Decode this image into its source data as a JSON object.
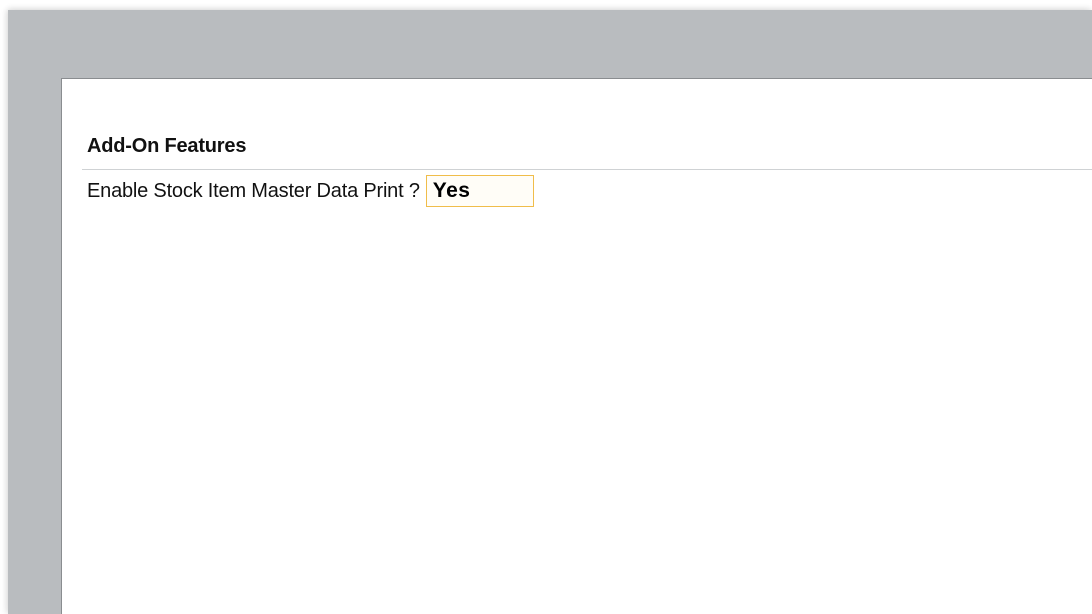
{
  "section": {
    "title": "Add-On Features"
  },
  "fields": [
    {
      "label": "Enable Stock Item Master Data Print ?",
      "value": "Yes"
    }
  ],
  "colors": {
    "background_frame": "#b9bcbf",
    "panel": "#ffffff",
    "focus_border": "#f0bd4a"
  }
}
